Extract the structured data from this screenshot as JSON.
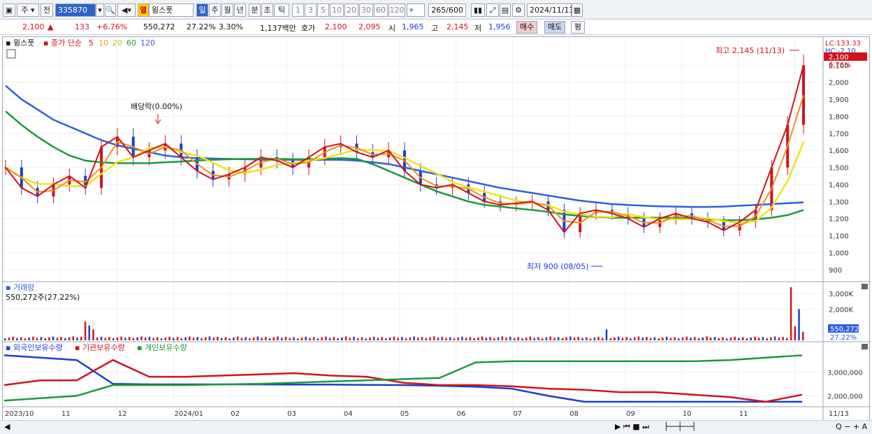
{
  "toolbar": {
    "period_code": "주",
    "prev_label": "전",
    "stock_code": "335870",
    "stock_name": "윙스풋",
    "flag_label": "열",
    "periods": [
      "일",
      "주",
      "월",
      "년",
      "분",
      "초",
      "틱"
    ],
    "ticks": [
      "1",
      "3",
      "5",
      "10",
      "20",
      "30",
      "60",
      "120"
    ],
    "count": "265",
    "count_total": "/600",
    "date": "2024/11/13"
  },
  "quote": {
    "price": "2,100",
    "change": "133",
    "change_pct": "+6.76%",
    "volume": "550,272",
    "turnover_pct": "27.22%",
    "pct2": "3.30%",
    "amount": "1,137백만",
    "ask_label": "호가",
    "ask": "2,100",
    "bid": "2,095",
    "open_label": "시",
    "open": "1,965",
    "high_label": "고",
    "high": "2,145",
    "low_label": "저",
    "low": "1,956",
    "buy_label": "매수",
    "sell_label": "매도",
    "eval_label": "평"
  },
  "price_panel": {
    "name": "윙스풋",
    "ma_label": "종가 단순",
    "ma_periods": [
      "5",
      "10",
      "20",
      "60",
      "120"
    ],
    "lc_label": "LC:133.33",
    "hc_label": "HC:-2.10",
    "current_price_tag": "2,100",
    "current_pct_tag": "6.76%",
    "high_annotation": "최고 2,145 (11/13)",
    "low_annotation": "최저 900 (08/05)",
    "dividend_annotation": "배당락(0.00%)"
  },
  "volume_panel": {
    "title": "거래량",
    "value_text": "550,272주(27.22%)",
    "tag_value": "550,272",
    "tag_pct": "27.22%"
  },
  "holdings_panel": {
    "labels": [
      "외국인보유수량",
      "기관보유수량",
      "개인보유수량"
    ]
  },
  "colors": {
    "up": "#d0141c",
    "down": "#1a3fd0",
    "ma5": "#d0141c",
    "ma10": "#f09020",
    "ma20": "#f2e21a",
    "ma60": "#1a9a3a",
    "ma120": "#2d5fe0",
    "foreign": "#1a3fd0",
    "inst": "#d0141c",
    "indiv": "#1a9a3a"
  },
  "chart_data": [
    {
      "type": "candlestick",
      "title": "",
      "x": [
        "2023/10",
        "11",
        "12",
        "2024/01",
        "02",
        "03",
        "04",
        "05",
        "06",
        "07",
        "08",
        "09",
        "10",
        "11",
        "11/13"
      ],
      "ylim": [
        850,
        2200
      ],
      "y_ticks": [
        900,
        1000,
        1100,
        1200,
        1300,
        1400,
        1500,
        1600,
        1700,
        1800,
        1900,
        2000,
        2100
      ],
      "series": [
        {
          "name": "close",
          "values": [
            1500,
            1380,
            1330,
            1400,
            1450,
            1380,
            1620,
            1680,
            1560,
            1600,
            1640,
            1560,
            1480,
            1430,
            1460,
            1500,
            1560,
            1540,
            1500,
            1560,
            1620,
            1640,
            1590,
            1560,
            1600,
            1480,
            1400,
            1380,
            1400,
            1350,
            1300,
            1280,
            1290,
            1300,
            1250,
            1120,
            1230,
            1250,
            1230,
            1200,
            1150,
            1200,
            1230,
            1200,
            1180,
            1130,
            1180,
            1250,
            1500,
            1750,
            2100
          ]
        },
        {
          "name": "ma120",
          "values": [
            1980,
            1900,
            1840,
            1780,
            1740,
            1700,
            1660,
            1630,
            1610,
            1590,
            1570,
            1560,
            1555,
            1552,
            1550,
            1548,
            1546,
            1545,
            1545,
            1545,
            1545,
            1545,
            1540,
            1530,
            1520,
            1500,
            1480,
            1460,
            1440,
            1420,
            1400,
            1380,
            1365,
            1350,
            1335,
            1320,
            1305,
            1295,
            1285,
            1280,
            1275,
            1272,
            1270,
            1268,
            1268,
            1270,
            1275,
            1280,
            1285,
            1290,
            1295
          ]
        },
        {
          "name": "ma60",
          "values": [
            1830,
            1750,
            1680,
            1620,
            1570,
            1540,
            1530,
            1525,
            1525,
            1525,
            1530,
            1535,
            1540,
            1545,
            1548,
            1550,
            1550,
            1550,
            1548,
            1548,
            1550,
            1555,
            1550,
            1520,
            1480,
            1440,
            1400,
            1360,
            1330,
            1300,
            1280,
            1270,
            1260,
            1250,
            1240,
            1225,
            1215,
            1210,
            1205,
            1205,
            1205,
            1205,
            1205,
            1200,
            1195,
            1190,
            1190,
            1195,
            1205,
            1220,
            1250
          ]
        }
      ],
      "high_label": "최고 2,145 (11/13)",
      "low_label": "최저 900 (08/05)"
    },
    {
      "type": "bar",
      "title": "거래량",
      "y_ticks": [
        "2,000K",
        "3,000K"
      ],
      "peak_value": 3400000,
      "last_value": 550272
    },
    {
      "type": "line",
      "title": "",
      "y_ticks": [
        "2,000,000",
        "3,000,000"
      ],
      "series": [
        {
          "name": "외국인보유수량",
          "values": [
            3700000,
            3600000,
            3500000,
            2500000,
            2480000,
            2480000,
            2480000,
            2480000,
            2470000,
            2470000,
            2460000,
            2450000,
            2420000,
            2380000,
            2300000,
            2000000,
            1750000,
            1750000,
            1750000,
            1750000,
            1750000,
            1750000,
            1750000
          ]
        },
        {
          "name": "기관보유수량",
          "values": [
            2450000,
            2650000,
            2650000,
            3500000,
            2800000,
            2800000,
            2850000,
            2900000,
            2950000,
            2850000,
            2800000,
            2550000,
            2450000,
            2450000,
            2400000,
            2300000,
            2250000,
            2150000,
            2150000,
            2050000,
            1950000,
            1750000,
            2050000
          ]
        },
        {
          "name": "개인보유수량",
          "values": [
            1800000,
            1900000,
            2000000,
            2450000,
            2450000,
            2450000,
            2480000,
            2500000,
            2550000,
            2600000,
            2650000,
            2700000,
            2750000,
            3400000,
            3450000,
            3450000,
            3450000,
            3450000,
            3450000,
            3450000,
            3500000,
            3600000,
            3700000
          ]
        }
      ]
    }
  ]
}
